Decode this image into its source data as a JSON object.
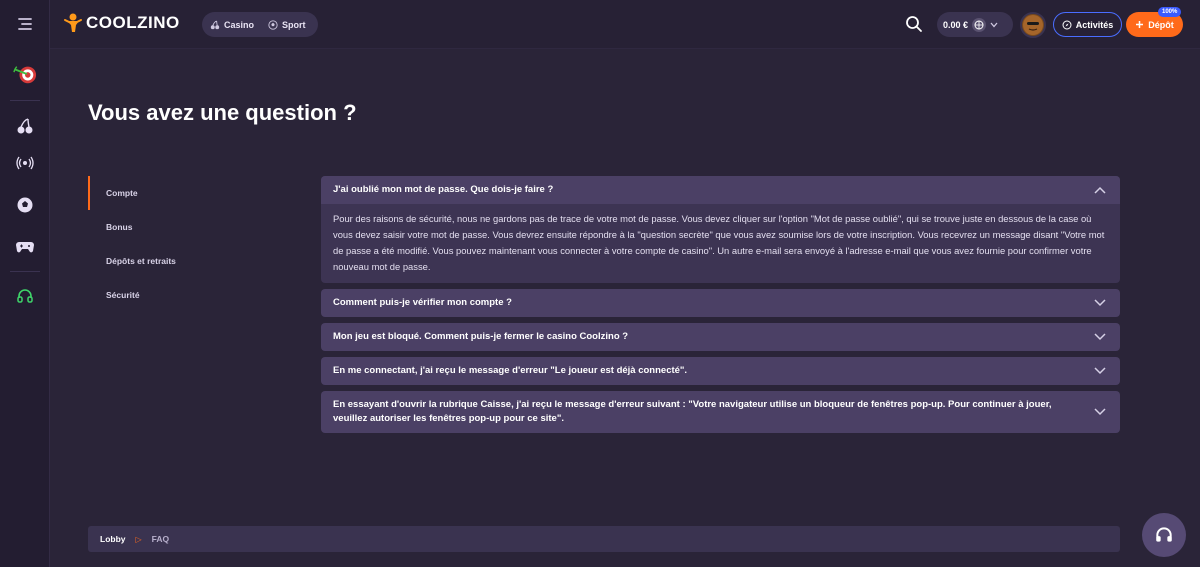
{
  "header": {
    "brand": "COOLZINO",
    "nav": [
      {
        "label": "Casino",
        "icon": "cherries-icon"
      },
      {
        "label": "Sport",
        "icon": "soccer-ball-icon"
      }
    ],
    "balance": "0.00 €",
    "activities_label": "Activités",
    "deposit_label": "Dépôt",
    "bonus_badge": "100%"
  },
  "sidebar_icons": [
    "menu-icon",
    "dart-target-icon",
    "cherries-icon",
    "live-broadcast-icon",
    "soccer-ball-icon",
    "gamepad-icon",
    "headset-icon"
  ],
  "page": {
    "title": "Vous avez une question ?"
  },
  "side_nav": [
    {
      "label": "Compte",
      "active": true
    },
    {
      "label": "Bonus",
      "active": false
    },
    {
      "label": "Dépôts et retraits",
      "active": false
    },
    {
      "label": "Sécurité",
      "active": false
    }
  ],
  "faq": [
    {
      "question": "J'ai oublié mon mot de passe. Que dois-je faire ?",
      "open": true,
      "answer": "Pour des raisons de sécurité, nous ne gardons pas de trace de votre mot de passe. Vous devez cliquer sur l'option \"Mot de passe oublié\", qui se trouve juste en dessous de la case où vous devez saisir votre mot de passe. Vous devrez ensuite répondre à la \"question secrète\" que vous avez soumise lors de votre inscription. Vous recevrez un message disant \"Votre mot de passe a été modifié. Vous pouvez maintenant vous connecter à votre compte de casino\". Un autre e-mail sera envoyé à l'adresse e-mail que vous avez fournie pour confirmer votre nouveau mot de passe."
    },
    {
      "question": "Comment puis-je vérifier mon compte ?",
      "open": false
    },
    {
      "question": "Mon jeu est bloqué. Comment puis-je fermer le casino Coolzino ?",
      "open": false
    },
    {
      "question": "En me connectant, j'ai reçu le message d'erreur \"Le joueur est déjà connecté\".",
      "open": false
    },
    {
      "question": "En essayant d'ouvrir la rubrique Caisse, j'ai reçu le message d'erreur suivant : \"Votre navigateur utilise un bloqueur de fenêtres pop-up. Pour continuer à jouer, veuillez autoriser les fenêtres pop-up pour ce site\".",
      "open": false
    }
  ],
  "breadcrumb": [
    "Lobby",
    "FAQ"
  ],
  "colors": {
    "accent": "#ff6a1a",
    "activities_border": "#4a6dff",
    "background": "#2a2438"
  }
}
